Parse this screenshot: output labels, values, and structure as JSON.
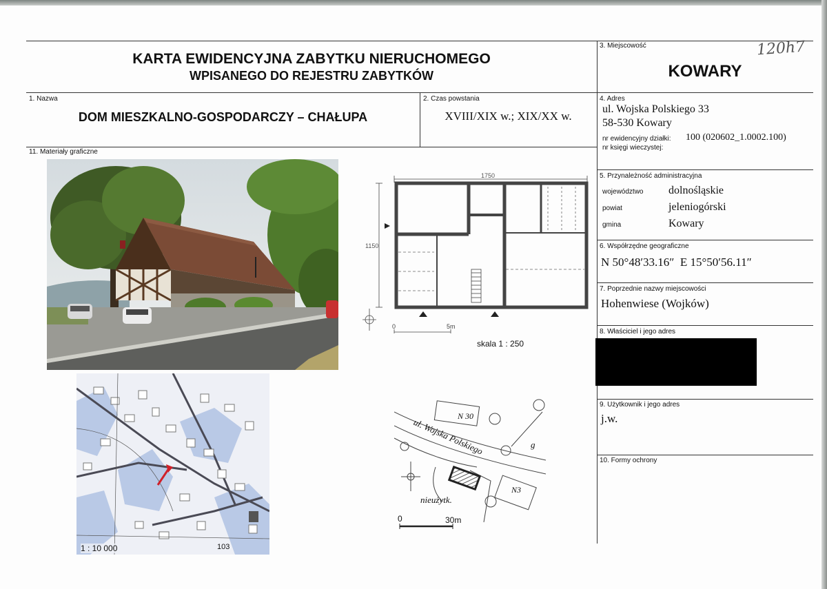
{
  "header": {
    "title_line1": "KARTA EWIDENCYJNA ZABYTKU NIERUCHOMEGO",
    "title_line2": "WPISANEGO DO REJESTRU ZABYTKÓW",
    "handwritten_number": "120h7"
  },
  "fields": {
    "miejscowosc": {
      "label": "3. Miejscowość",
      "value": "KOWARY"
    },
    "nazwa": {
      "label": "1. Nazwa",
      "value": "DOM MIESZKALNO-GOSPODARCZY – CHAŁUPA"
    },
    "czas": {
      "label": "2. Czas powstania",
      "value": "XVIII/XIX w.; XIX/XX w."
    },
    "adres": {
      "label": "4. Adres",
      "line1": "ul. Wojska Polskiego 33",
      "line2": "58-530 Kowary",
      "dzialka_label": "nr ewidencyjny działki:",
      "dzialka_value": "100 (020602_1.0002.100)",
      "ksiega_label": "nr księgi wieczystej:"
    },
    "materialy": {
      "label": "11. Materiały graficzne"
    },
    "przynaleznosc": {
      "label": "5. Przynależność administracyjna",
      "woj_label": "województwo",
      "woj_value": "dolnośląskie",
      "pow_label": "powiat",
      "pow_value": "jeleniogórski",
      "gmina_label": "gmina",
      "gmina_value": "Kowary"
    },
    "wspolrzedne": {
      "label": "6. Współrzędne geograficzne",
      "value": "N 50°48′33.16″  E 15°50′56.11″"
    },
    "poprzednie": {
      "label": "7. Poprzednie nazwy miejscowości",
      "value": "Hohenwiese (Wojków)"
    },
    "wlasciciel": {
      "label": "8. Właściciel i jego adres"
    },
    "uzytkownik": {
      "label": "9. Użytkownik i jego adres",
      "value": "j.w."
    },
    "ochrona": {
      "label": "10. Formy ochrony"
    }
  },
  "plan": {
    "width_dim": "1750",
    "height_dim": "1150",
    "scale_zero": "0",
    "scale_five": "5m",
    "scale_text": "skala 1 : 250"
  },
  "situation": {
    "street": "ul. Wojska Polskiego",
    "n30": "N 30",
    "n3": "N3",
    "nieuzytk": "nieużytk.",
    "g": "g",
    "zero": "0",
    "thirty": "30m"
  },
  "topomap": {
    "scale": "1 : 10 000",
    "sheet": "103"
  }
}
